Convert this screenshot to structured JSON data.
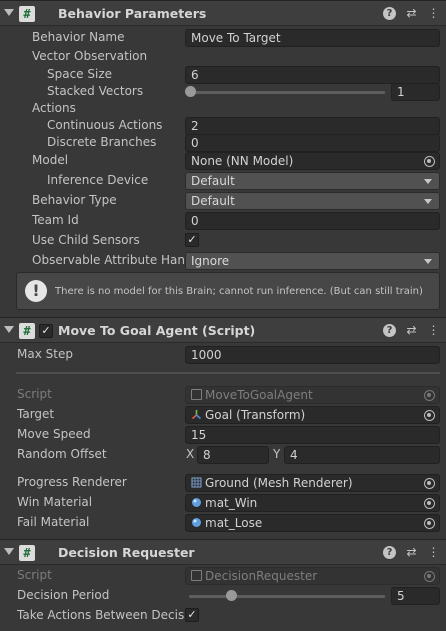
{
  "behavior_parameters": {
    "title": "Behavior Parameters",
    "behavior_name_label": "Behavior Name",
    "behavior_name_value": "Move To Target",
    "vector_observation_label": "Vector Observation",
    "space_size_label": "Space Size",
    "space_size_value": "6",
    "stacked_vectors_label": "Stacked Vectors",
    "stacked_vectors_value": "1",
    "stacked_vectors_level": 0,
    "actions_label": "Actions",
    "continuous_actions_label": "Continuous Actions",
    "continuous_actions_value": "2",
    "discrete_branches_label": "Discrete Branches",
    "discrete_branches_value": "0",
    "model_label": "Model",
    "model_value": "None (NN Model)",
    "inference_device_label": "Inference Device",
    "inference_device_value": "Default",
    "behavior_type_label": "Behavior Type",
    "behavior_type_value": "Default",
    "team_id_label": "Team Id",
    "team_id_value": "0",
    "use_child_sensors_label": "Use Child Sensors",
    "use_child_sensors_checked": true,
    "observable_attr_label": "Observable Attribute Handl",
    "observable_attr_value": "Ignore",
    "help_text": "There is no model for this Brain; cannot run inference. (But can still train)"
  },
  "move_to_goal_agent": {
    "title": "Move To Goal Agent (Script)",
    "enabled": true,
    "max_step_label": "Max Step",
    "max_step_value": "1000",
    "script_label": "Script",
    "script_value": "MoveToGoalAgent",
    "target_label": "Target",
    "target_value": "Goal (Transform)",
    "move_speed_label": "Move Speed",
    "move_speed_value": "15",
    "random_offset_label": "Random Offset",
    "random_offset_x_label": "X",
    "random_offset_x": "8",
    "random_offset_y_label": "Y",
    "random_offset_y": "4",
    "progress_renderer_label": "Progress Renderer",
    "progress_renderer_value": "Ground (Mesh Renderer)",
    "win_material_label": "Win Material",
    "win_material_value": "mat_Win",
    "fail_material_label": "Fail Material",
    "fail_material_value": "mat_Lose"
  },
  "decision_requester": {
    "title": "Decision Requester",
    "script_label": "Script",
    "script_value": "DecisionRequester",
    "decision_period_label": "Decision Period",
    "decision_period_value": "5",
    "decision_period_level": 0.25,
    "take_actions_label": "Take Actions Between Decisi",
    "take_actions_checked": true
  },
  "header_icons": [
    "help-icon",
    "presets-icon",
    "more-options-icon"
  ],
  "colors": {
    "background": "#383838",
    "header": "#3e3e3e",
    "field": "#2a2a2a",
    "script_icon_hash": "#1e6f3a",
    "text": "#c4c4c4"
  }
}
